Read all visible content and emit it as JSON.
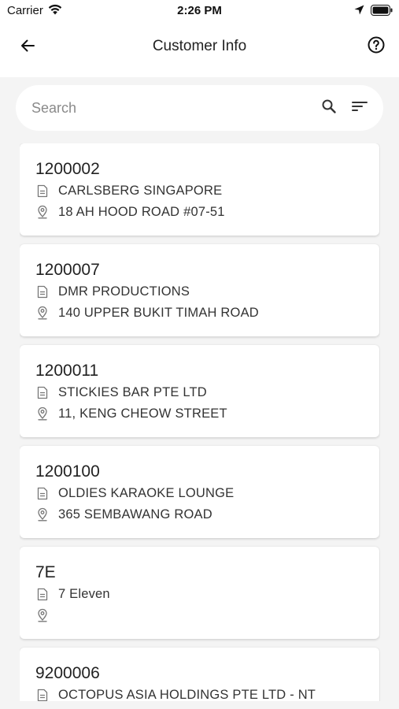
{
  "status_bar": {
    "carrier": "Carrier",
    "time": "2:26 PM"
  },
  "app_bar": {
    "title": "Customer Info"
  },
  "search": {
    "placeholder": "Search",
    "value": ""
  },
  "customers": [
    {
      "code": "1200002",
      "name": "CARLSBERG SINGAPORE",
      "address": "18 AH HOOD ROAD #07-51"
    },
    {
      "code": "1200007",
      "name": "DMR PRODUCTIONS",
      "address": "140 UPPER BUKIT TIMAH ROAD"
    },
    {
      "code": "1200011",
      "name": "STICKIES BAR PTE LTD",
      "address": "11, KENG CHEOW STREET"
    },
    {
      "code": "1200100",
      "name": "OLDIES KARAOKE LOUNGE",
      "address": "365 SEMBAWANG ROAD"
    },
    {
      "code": "7E",
      "name": "7 Eleven",
      "address": ""
    },
    {
      "code": "9200006",
      "name": "OCTOPUS ASIA HOLDINGS PTE LTD - NT",
      "address": ""
    }
  ],
  "icons": {
    "wifi": "wifi-icon",
    "location": "location-arrow-icon",
    "battery": "battery-icon",
    "back": "arrow-left-icon",
    "help": "help-circle-icon",
    "search": "search-icon",
    "filter": "sort-filter-icon",
    "name": "document-icon",
    "address": "map-pin-icon"
  }
}
